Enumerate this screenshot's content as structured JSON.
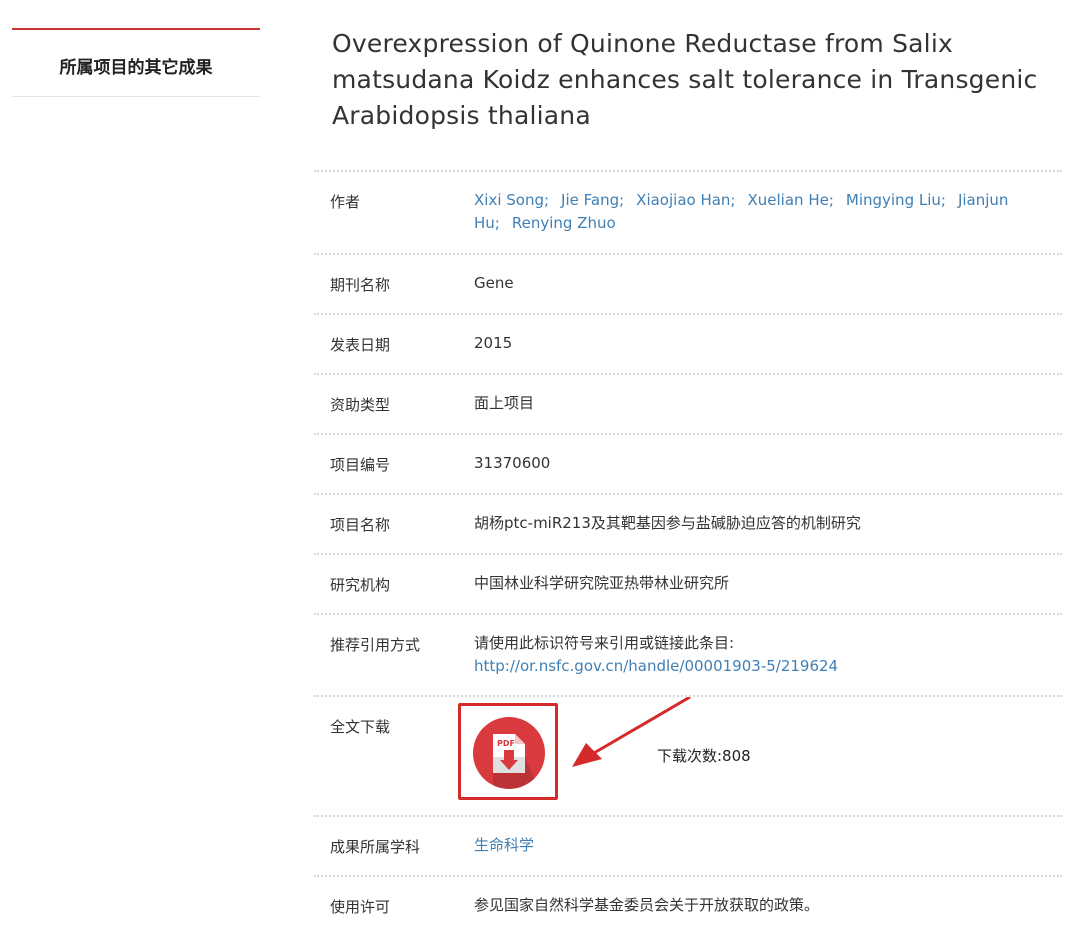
{
  "sidebar": {
    "title": "所属项目的其它成果"
  },
  "record": {
    "title": "Overexpression of Quinone Reductase from Salix matsudana Koidz enhances salt tolerance in Transgenic Arabidopsis thaliana"
  },
  "fields": {
    "authors_label": "作者",
    "authors": [
      "Xixi Song;",
      "Jie Fang;",
      "Xiaojiao Han;",
      "Xuelian He;",
      "Mingying Liu;",
      "Jianjun Hu;",
      "Renying Zhuo"
    ],
    "journal_label": "期刊名称",
    "journal": "Gene",
    "date_label": "发表日期",
    "date": "2015",
    "funding_label": "资助类型",
    "funding": "面上项目",
    "project_no_label": "项目编号",
    "project_no": "31370600",
    "project_name_label": "项目名称",
    "project_name": "胡杨ptc-miR213及其靶基因参与盐碱胁迫应答的机制研究",
    "institution_label": "研究机构",
    "institution": "中国林业科学研究院亚热带林业研究所",
    "citation_label": "推荐引用方式",
    "citation_text": "请使用此标识符号来引用或链接此条目:",
    "citation_url": "http://or.nsfc.gov.cn/handle/00001903-5/219624",
    "fulltext_label": "全文下载",
    "pdf_icon_text": "PDF",
    "download_count": "下载次数:808",
    "subject_label": "成果所属学科",
    "subject": "生命科学",
    "license_label": "使用许可",
    "license": "参见国家自然科学基金委员会关于开放获取的政策。"
  },
  "colors": {
    "accent": "#c8352e",
    "link": "#3f7fb5",
    "pdf": "#d83a3d"
  },
  "icons": [
    "pdf-download-icon",
    "red-arrow"
  ]
}
